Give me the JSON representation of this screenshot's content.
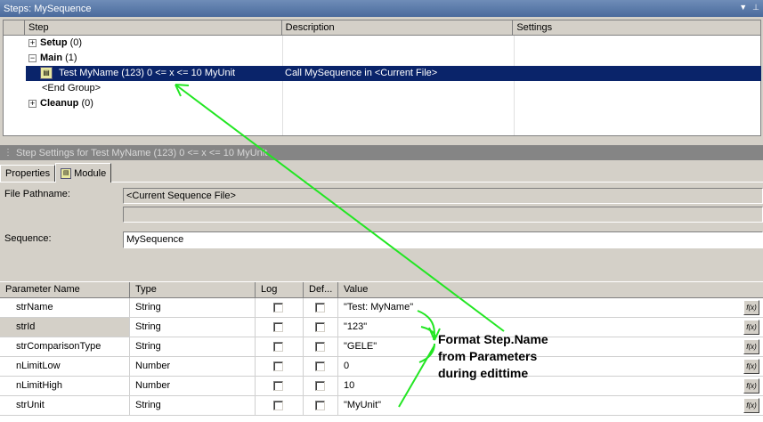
{
  "steps_window": {
    "title": "Steps: MySequence",
    "columns": [
      "Step",
      "Description",
      "Settings"
    ],
    "groups": {
      "setup": {
        "label": "Setup",
        "count": "(0)"
      },
      "main": {
        "label": "Main",
        "count": "(1)"
      },
      "end_group": "<End Group>",
      "cleanup": {
        "label": "Cleanup",
        "count": "(0)"
      }
    },
    "selected_step": {
      "name": "Test MyName (123) 0 <= x <= 10 MyUnit",
      "description": "Call MySequence in <Current File>"
    }
  },
  "settings_window": {
    "title": "Step Settings for Test MyName (123) 0 <= x <= 10 MyUnit",
    "tabs": [
      "Properties",
      "Module"
    ],
    "file_pathname_label": "File Pathname:",
    "file_pathname_value": "<Current Sequence File>",
    "sequence_label": "Sequence:",
    "sequence_value": "MySequence"
  },
  "parameters": {
    "columns": [
      "Parameter Name",
      "Type",
      "Log",
      "Def...",
      "Value"
    ],
    "rows": [
      {
        "name": "strName",
        "type": "String",
        "value": "\"Test: MyName\""
      },
      {
        "name": "strId",
        "type": "String",
        "value": "\"123\""
      },
      {
        "name": "strComparisonType",
        "type": "String",
        "value": "\"GELE\""
      },
      {
        "name": "nLimitLow",
        "type": "Number",
        "value": "0"
      },
      {
        "name": "nLimitHigh",
        "type": "Number",
        "value": "10"
      },
      {
        "name": "strUnit",
        "type": "String",
        "value": "\"MyUnit\""
      }
    ],
    "fx_label": "f(x)"
  },
  "annotation": {
    "line1": "Format Step.Name",
    "line2": "from Parameters",
    "line3": "during edittime",
    "color": "#22e622"
  },
  "colors": {
    "selection": "#0a246a",
    "title_active": "#4a6a9c",
    "face": "#d4d0c8"
  }
}
